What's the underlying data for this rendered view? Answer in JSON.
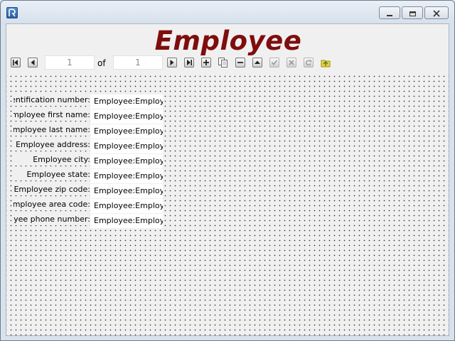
{
  "window": {
    "icon": "app-icon",
    "controls": {
      "minimize": "minimize-icon",
      "restore": "restore-icon",
      "close": "close-icon"
    }
  },
  "form": {
    "title": "Employee",
    "title_color": "#7f0d0d"
  },
  "toolbar": {
    "current_record": "1",
    "of_label": "of",
    "total_records": "1",
    "buttons": [
      "first-record-icon",
      "previous-record-icon",
      "next-record-icon",
      "last-record-icon",
      "add-record-icon",
      "copy-record-icon",
      "delete-record-icon",
      "upload-icon",
      "save-check-icon",
      "cancel-icon",
      "refresh-icon",
      "query-icon"
    ]
  },
  "fields": [
    {
      "label": "Employee identification number:",
      "value": "Employee:Employee"
    },
    {
      "label": "Employee first name:",
      "value": "Employee:Employee"
    },
    {
      "label": "Employee last name:",
      "value": "Employee:Employee"
    },
    {
      "label": "Employee address:",
      "value": "Employee:Employee"
    },
    {
      "label": "Employee city:",
      "value": "Employee:Employee"
    },
    {
      "label": "Employee state:",
      "value": "Employee:Employee"
    },
    {
      "label": "Employee zip code:",
      "value": "Employee:Employee"
    },
    {
      "label": "Employee area code:",
      "value": "Employee:Employee"
    },
    {
      "label": "Employee phone number:",
      "value": "Employee:Employee"
    }
  ]
}
